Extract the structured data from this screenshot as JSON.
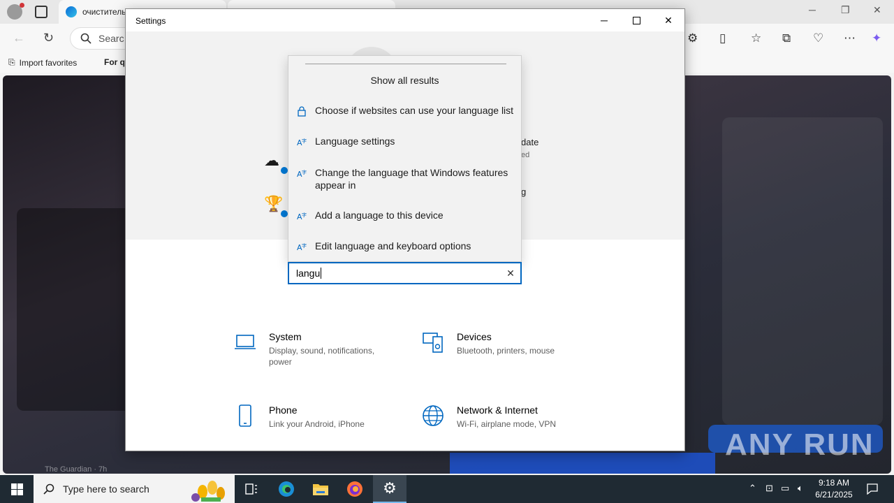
{
  "browser": {
    "tab_title": "очиститель",
    "address_placeholder": "Searc",
    "favorites": [
      {
        "label": "Import favorites"
      },
      {
        "label": "For qu"
      }
    ],
    "feed_source": "The Guardian · 7h"
  },
  "watermark": "ANY RUN",
  "settings": {
    "window_title": "Settings",
    "hero": {
      "update_title": "date",
      "update_sub": "ed",
      "rewards_title": "g"
    },
    "search": {
      "value": "langu",
      "show_all": "Show all results",
      "results": [
        {
          "label": "Choose if websites can use your language list",
          "icon": "lock-icon"
        },
        {
          "label": "Language settings",
          "icon": "language-icon"
        },
        {
          "label": "Change the language that Windows features appear in",
          "icon": "language-icon"
        },
        {
          "label": "Add a language to this device",
          "icon": "language-icon"
        },
        {
          "label": "Edit language and keyboard options",
          "icon": "language-icon"
        }
      ]
    },
    "categories": [
      {
        "title": "System",
        "desc": "Display, sound, notifications, power",
        "icon": "laptop-icon"
      },
      {
        "title": "Devices",
        "desc": "Bluetooth, printers, mouse",
        "icon": "devices-icon"
      },
      {
        "title": "Phone",
        "desc": "Link your Android, iPhone",
        "icon": "phone-icon"
      },
      {
        "title": "Network & Internet",
        "desc": "Wi-Fi, airplane mode, VPN",
        "icon": "globe-icon"
      }
    ]
  },
  "taskbar": {
    "search_placeholder": "Type here to search",
    "time": "9:18 AM",
    "date": "6/21/2025"
  },
  "colors": {
    "accent": "#0067c0",
    "taskbar": "#1f2a33"
  }
}
